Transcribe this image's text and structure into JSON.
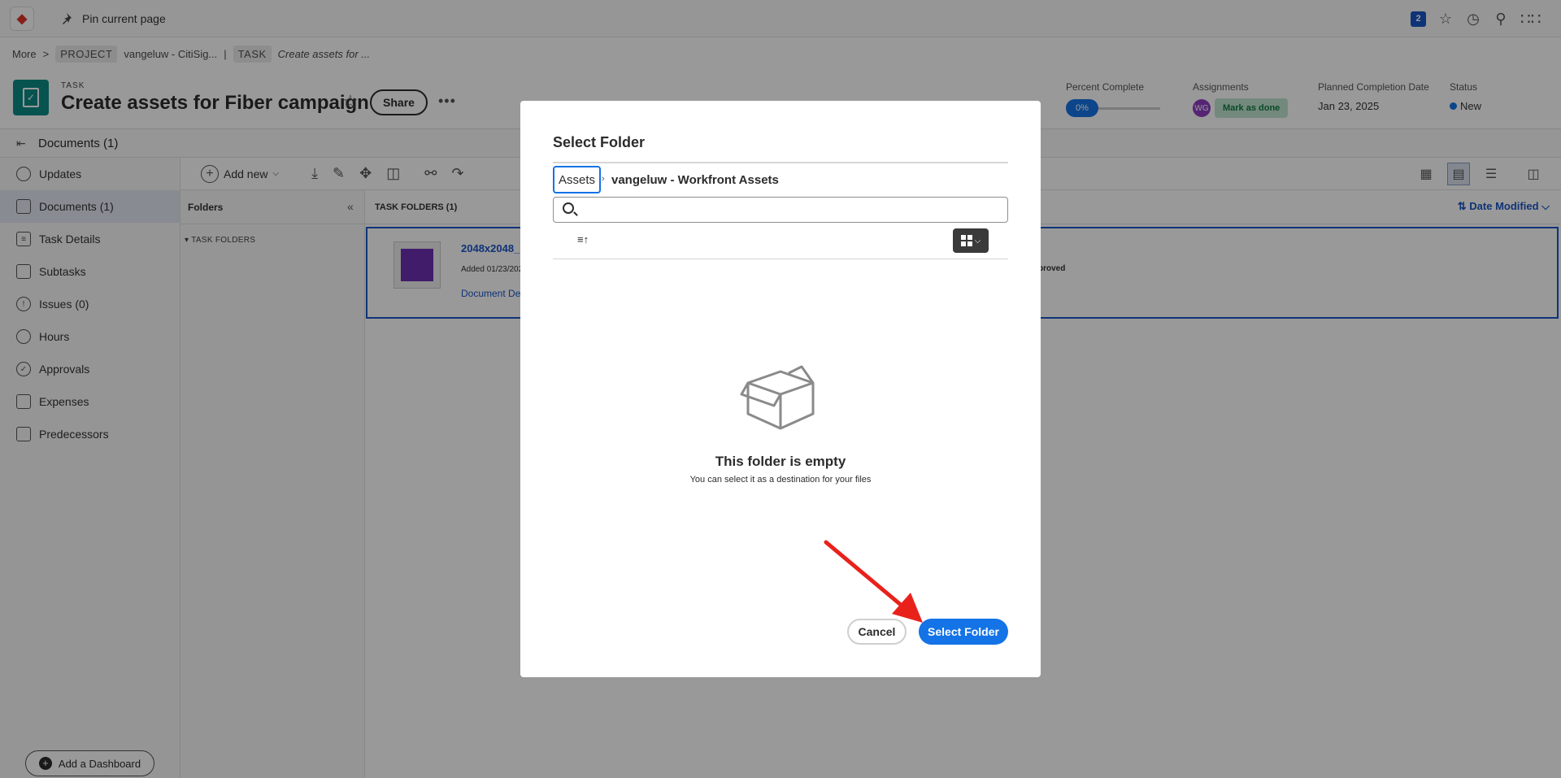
{
  "topbar": {
    "brave_icon": "brave-lion-icon",
    "pin_label": "Pin current page",
    "notification_count": "2"
  },
  "breadcrumb": {
    "more": "More",
    "separator": ">",
    "project_tag": "PROJECT",
    "project_name": "vangeluw - CitiSig...",
    "divider": "|",
    "task_tag": "TASK",
    "task_name": "Create assets for ..."
  },
  "header": {
    "type_label": "TASK",
    "title": "Create assets for Fiber campaign",
    "share_label": "Share",
    "more_label": "•••",
    "percent_complete_label": "Percent Complete",
    "percent_complete_value": "0%",
    "assignments_label": "Assignments",
    "assignee_initials": "WG",
    "mark_done_label": "Mark as done",
    "planned_completion_label": "Planned Completion Date",
    "planned_completion_value": "Jan 23, 2025",
    "status_label": "Status",
    "status_value": "New",
    "status_color": "#1473e6"
  },
  "docs_bar": {
    "title": "Documents (1)"
  },
  "sidebar": {
    "items": [
      {
        "label": "Updates",
        "icon": "chat-bubble-icon"
      },
      {
        "label": "Documents (1)",
        "icon": "document-icon"
      },
      {
        "label": "Task Details",
        "icon": "details-list-icon"
      },
      {
        "label": "Subtasks",
        "icon": "subtasks-icon"
      },
      {
        "label": "Issues (0)",
        "icon": "issue-bubble-icon"
      },
      {
        "label": "Hours",
        "icon": "clock-icon"
      },
      {
        "label": "Approvals",
        "icon": "check-circle-icon"
      },
      {
        "label": "Expenses",
        "icon": "money-icon"
      },
      {
        "label": "Predecessors",
        "icon": "predecessor-icon"
      }
    ],
    "add_dashboard_label": "Add a Dashboard"
  },
  "toolbar": {
    "add_new_label": "Add new"
  },
  "folders": {
    "header": "Folders",
    "task_folders_label": "TASK FOLDERS"
  },
  "content": {
    "header": "TASK FOLDERS (1)",
    "sort_label": "Date Modified",
    "doc_name": "2048x2048_",
    "doc_added": "Added 01/23/202",
    "doc_link": "Document De",
    "doc_status_fragment": "proved"
  },
  "dialog": {
    "title": "Select Folder",
    "crumb_root": "Assets",
    "crumb_current": "vangeluw - Workfront Assets",
    "search_placeholder": "",
    "empty_title": "This folder is empty",
    "empty_subtitle": "You can select it as a destination for your files",
    "cancel_label": "Cancel",
    "select_label": "Select Folder",
    "accent_color": "#1473e6"
  },
  "annotation": {
    "arrow_color": "#e8221b"
  }
}
